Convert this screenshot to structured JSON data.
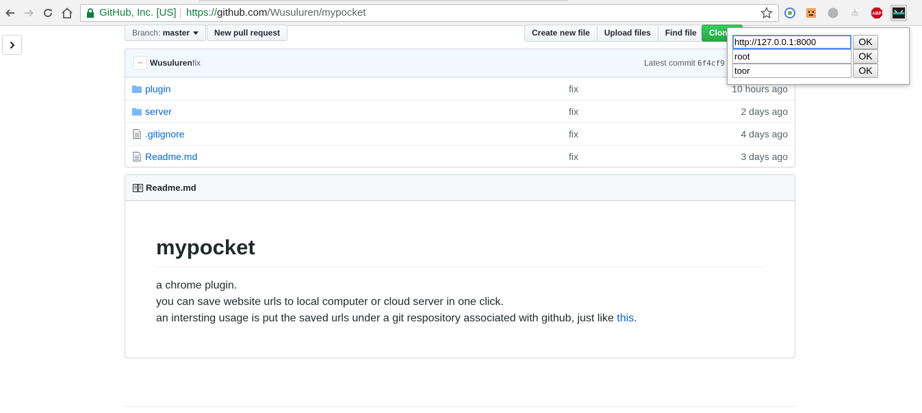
{
  "browser": {
    "ev_label": "GitHub, Inc. [US]",
    "url_scheme": "https://",
    "url_host": "github.com",
    "url_path": "/Wusuluren/mypocket",
    "extensions": [
      "translate-icon",
      "face-extension-icon",
      "gray-circle-icon",
      "tree-icon",
      "adblock-plus-icon",
      "pocket-extension-icon"
    ],
    "abp_label": "ABP"
  },
  "repo": {
    "branch_prefix": "Branch:",
    "branch_name": "master",
    "new_pull_request": "New pull request",
    "create_new_file": "Create new file",
    "upload_files": "Upload files",
    "find_file": "Find file",
    "clone_label": "Clone or download"
  },
  "commit": {
    "author": "Wusuluren",
    "message": "fix",
    "latest_label": "Latest commit",
    "sha": "6f4cf9"
  },
  "files": [
    {
      "name": "plugin",
      "type": "folder",
      "message": "fix",
      "age": "10 hours ago"
    },
    {
      "name": "server",
      "type": "folder",
      "message": "fix",
      "age": "2 days ago"
    },
    {
      "name": ".gitignore",
      "type": "file",
      "message": "fix",
      "age": "4 days ago"
    },
    {
      "name": "Readme.md",
      "type": "file",
      "message": "fix",
      "age": "3 days ago"
    }
  ],
  "readme": {
    "filename": "Readme.md",
    "heading": "mypocket",
    "line1": "a chrome plugin.",
    "line2": "you can save website urls to local computer or cloud server in one click.",
    "line3_text": "an intersting usage is put the saved urls under a git respository associated with github, just like ",
    "line3_link": "this",
    "line3_end": "."
  },
  "popup": {
    "fields": [
      {
        "value": "http://127.0.0.1:8000",
        "button": "OK"
      },
      {
        "value": "root",
        "button": "OK"
      },
      {
        "value": "toor",
        "button": "OK"
      }
    ]
  },
  "colors": {
    "link": "#0366d6",
    "clone_green": "#28a745",
    "secure_green": "#0b8043"
  }
}
